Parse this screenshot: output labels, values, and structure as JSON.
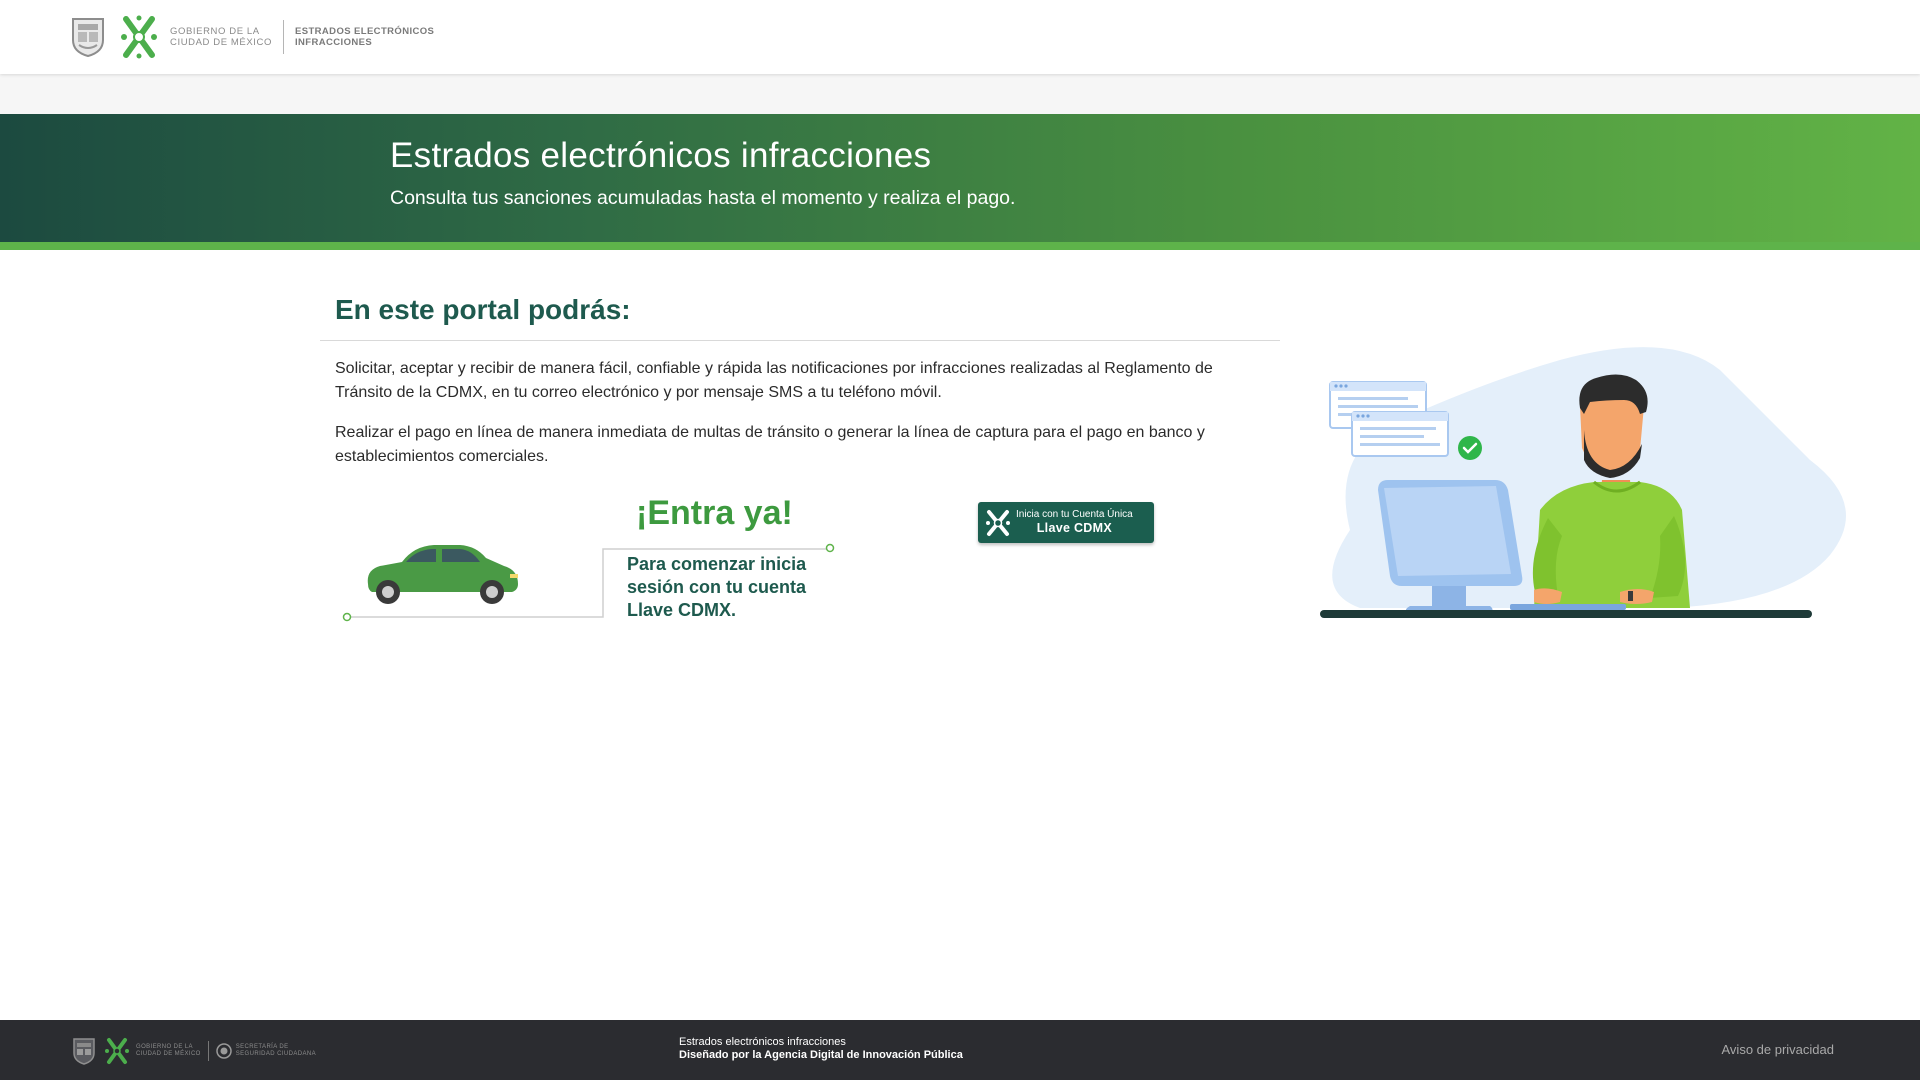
{
  "header": {
    "gov_line1": "GOBIERNO DE LA",
    "gov_line2": "CIUDAD DE MÉXICO",
    "site_line1": "ESTRADOS ELECTRÓNICOS",
    "site_line2": "INFRACCIONES"
  },
  "hero": {
    "title": "Estrados electrónicos infracciones",
    "subtitle": "Consulta tus sanciones acumuladas hasta el momento y realiza el pago."
  },
  "main": {
    "title": "En este portal podrás:",
    "paragraph1": "Solicitar, aceptar y recibir de manera fácil, confiable y rápida las notificaciones por infracciones realizadas al Reglamento de Tránsito de la CDMX, en tu correo electrónico y por mensaje SMS a tu teléfono móvil.",
    "paragraph2": "Realizar el pago en línea de manera inmediata de multas de tránsito o generar la línea de captura para el pago en banco y establecimientos comerciales.",
    "entra_title": "¡Entra ya!",
    "entra_note": "Para comenzar inicia sesión con tu cuenta Llave CDMX."
  },
  "login_button": {
    "line1": "Inicia con tu Cuenta Única",
    "line2": "Llave CDMX"
  },
  "footer": {
    "gov_line1": "GOBIERNO DE LA",
    "gov_line2": "CIUDAD DE MÉXICO",
    "sec_line1": "SECRETARÍA DE",
    "sec_line2": "SEGURIDAD CIUDADANA",
    "center_line1": "Estrados electrónicos infracciones",
    "center_line2": "Diseñado por la Agencia Digital de Innovación Pública",
    "privacy_link": "Aviso de privacidad"
  },
  "colors": {
    "brand_green": "#3d9a3f",
    "dark_green": "#1e5a4e",
    "footer_bg": "#2b2c30"
  },
  "icons": [
    "coat-of-arms-icon",
    "cdmx-logo-icon",
    "car-icon",
    "llave-logo-icon",
    "seal-icon"
  ]
}
